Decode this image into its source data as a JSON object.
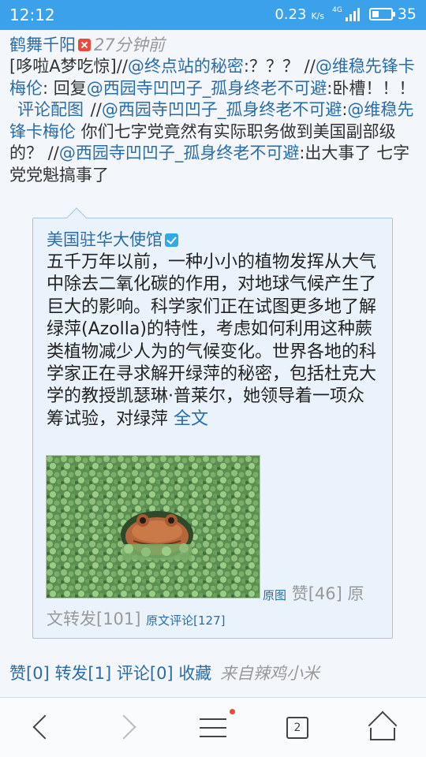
{
  "status_bar": {
    "time": "12:12",
    "net_rate": "0.23",
    "net_unit": "K/s",
    "network": "4G",
    "battery": "35",
    "battery_level": 0.35
  },
  "post": {
    "author": "鹤舞千阳",
    "time": "27分钟前",
    "body": {
      "t1": "[哆啦A梦吃惊]//",
      "l1": "@终点站的秘密",
      "t2": ":？？？ //",
      "l2": "@维稳先锋卡梅伦",
      "t3": ": 回复",
      "l3": "@西园寺凹凹子_孤身终老不可避",
      "t4": ":卧槽！！！",
      "l4": "评论配图",
      "t5": " //",
      "l5": "@西园寺凹凹子_孤身终老不可避",
      "t6": ":",
      "l6": "@维稳先锋卡梅伦",
      "t7": " 你们七字党竟然有实际职务做到美国副部级的？ //",
      "l7": "@西园寺凹凹子_孤身终老不可避",
      "t8": ":出大事了 七字党党魁搞事了"
    }
  },
  "repost": {
    "author": "美国驻华大使馆",
    "text": "五千万年以前，一种小小的植物发挥从大气中除去二氧化碳的作用，对地球气候产生了巨大的影响。科学家们正在试图更多地了解绿萍(Azolla)的特性，考虑如何利用这种蕨类植物减少人为的气候变化。世界各地的科学家正在寻求解开绿萍的秘密，包括杜克大学的教授凯瑟琳·普莱尔，她领导着一项众筹试验，对绿萍",
    "full_text_link": "全文",
    "original_image_link": "原图",
    "likes": "赞[46]",
    "reposts": "原文转发[101]",
    "comments": "原文评论[127]"
  },
  "actions": {
    "like": "赞[0]",
    "repost": "转发[1]",
    "comment": "评论[0]",
    "favorite": "收藏",
    "from": "来自辣鸡小米"
  },
  "bottom_nav": {
    "tab_count": "2"
  }
}
